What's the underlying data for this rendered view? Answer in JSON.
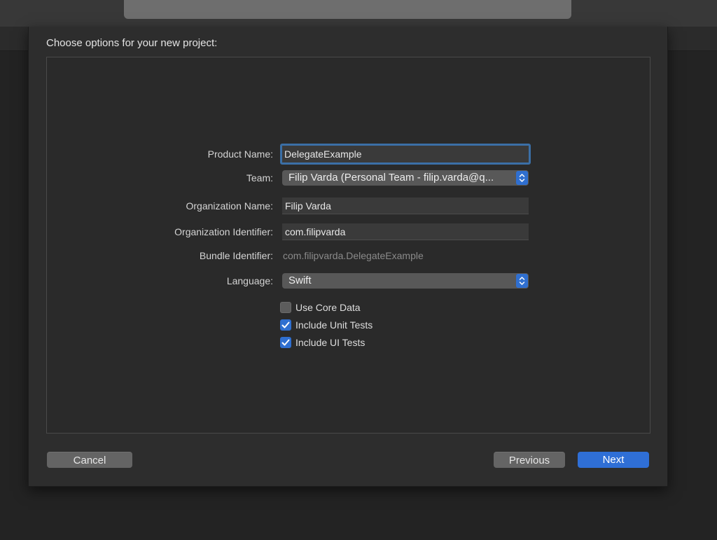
{
  "sheet": {
    "title": "Choose options for your new project:"
  },
  "form": {
    "product_name": {
      "label": "Product Name:",
      "value": "DelegateExample"
    },
    "team": {
      "label": "Team:",
      "value": "Filip Varda (Personal Team - filip.varda@q..."
    },
    "organization_name": {
      "label": "Organization Name:",
      "value": "Filip Varda"
    },
    "organization_identifier": {
      "label": "Organization Identifier:",
      "value": "com.filipvarda"
    },
    "bundle_identifier": {
      "label": "Bundle Identifier:",
      "value": "com.filipvarda.DelegateExample"
    },
    "language": {
      "label": "Language:",
      "value": "Swift"
    }
  },
  "options": [
    {
      "label": "Use Core Data",
      "checked": false
    },
    {
      "label": "Include Unit Tests",
      "checked": true
    },
    {
      "label": "Include UI Tests",
      "checked": true
    }
  ],
  "buttons": {
    "cancel": "Cancel",
    "previous": "Previous",
    "next": "Next"
  },
  "colors": {
    "accent": "#2f6fd6",
    "focus_ring": "#3b6fa6",
    "sheet_background": "#2d2d2d"
  },
  "icons": {
    "popup_stepper": "chevron-up-down-icon",
    "checkmark": "checkmark-icon"
  }
}
